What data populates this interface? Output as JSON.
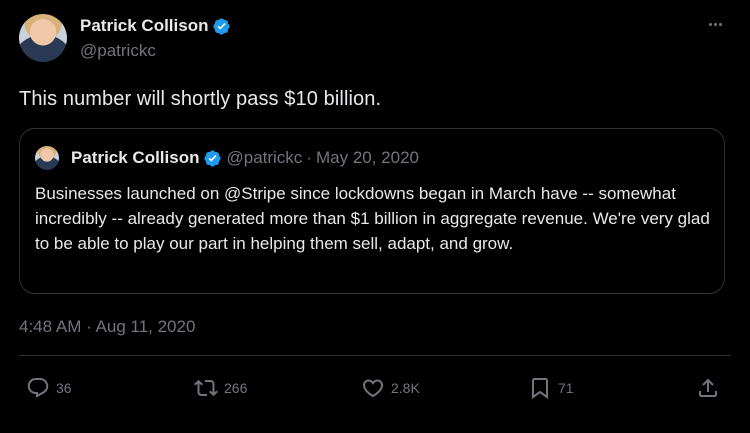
{
  "author": {
    "name": "Patrick Collison",
    "handle": "@patrickc",
    "verified": true
  },
  "tweet": {
    "text": "This number will shortly pass $10 billion.",
    "timestamp": "4:48 AM · Aug 11, 2020"
  },
  "quoted": {
    "name": "Patrick Collison",
    "handle": "@patrickc",
    "separator": "·",
    "date": "May 20, 2020",
    "text": "Businesses launched on @Stripe since lockdowns began in March have -- somewhat incredibly -- already generated more than $1 billion in aggregate revenue. We're very glad to be able to play our part in helping them sell, adapt, and grow."
  },
  "actions": {
    "replies": "36",
    "retweets": "266",
    "likes": "2.8K",
    "bookmarks": "71"
  },
  "colors": {
    "background": "#000000",
    "text": "#e7e9ea",
    "muted": "#71767b",
    "border": "#2f3336",
    "verified": "#1d9bf0"
  },
  "icons": [
    "verified-badge-icon",
    "more-icon",
    "reply-icon",
    "retweet-icon",
    "like-icon",
    "bookmark-icon",
    "share-icon"
  ]
}
